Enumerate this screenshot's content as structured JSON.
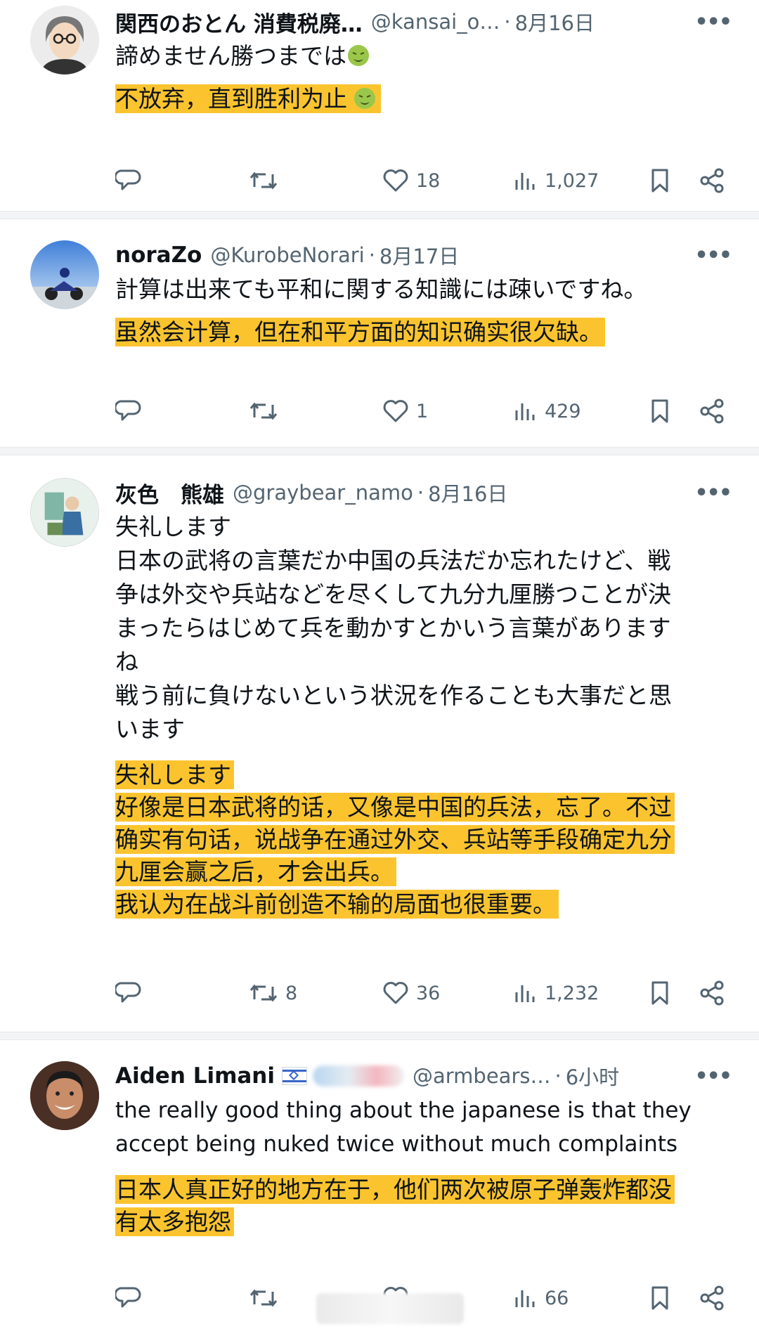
{
  "posts": [
    {
      "name": "関西のおとん 消費税廃…",
      "handle": "@kansai_o…",
      "date": "8月16日",
      "text_lines": [
        "諦めません勝つまでは"
      ],
      "translation_lines": [
        "不放弃，直到胜利为止"
      ],
      "stats": {
        "reply": "",
        "retweet": "",
        "like": "18",
        "views": "1,027"
      }
    },
    {
      "name": "noraZo",
      "handle": "@KurobeNorari",
      "date": "8月17日",
      "text_lines": [
        "計算は出来ても平和に関する知識には疎いですね。"
      ],
      "translation_lines": [
        "虽然会计算，但在和平方面的知识确实很欠缺。"
      ],
      "stats": {
        "reply": "",
        "retweet": "",
        "like": "1",
        "views": "429"
      }
    },
    {
      "name": "灰色　熊雄",
      "handle": "@graybear_namo",
      "date": "8月16日",
      "text_lines": [
        "失礼します",
        "日本の武将の言葉だか中国の兵法だか忘れたけど、戦",
        "争は外交や兵站などを尽くして九分九厘勝つことが決",
        "まったらはじめて兵を動かすとかいう言葉があります",
        "ね",
        "戦う前に負けないという状況を作ることも大事だと思",
        "います"
      ],
      "translation_lines": [
        "失礼します",
        "好像是日本武将的话，又像是中国的兵法，忘了。不过",
        "确实有句话，说战争在通过外交、兵站等手段确定九分",
        "九厘会赢之后，才会出兵。",
        "我认为在战斗前创造不输的局面也很重要。"
      ],
      "stats": {
        "reply": "",
        "retweet": "8",
        "like": "36",
        "views": "1,232"
      }
    },
    {
      "name": "Aiden Limani",
      "handle": "@armbears…",
      "date": "6小时",
      "text_lines": [
        "the really good thing about the japanese is that they",
        "accept being nuked twice without much complaints"
      ],
      "translation_lines": [
        "日本人真正好的地方在于，他们两次被原子弹轰炸都没",
        "有太多抱怨"
      ],
      "stats": {
        "reply": "",
        "retweet": "",
        "like": "",
        "views": "66"
      }
    }
  ],
  "ui": {
    "more": "•••",
    "dot": "·"
  }
}
